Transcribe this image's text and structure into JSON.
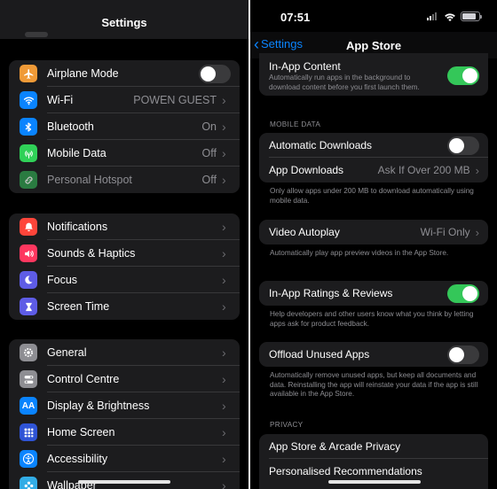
{
  "left": {
    "title": "Settings",
    "groups": [
      {
        "rows": [
          {
            "label": "Airplane Mode",
            "icon": "airplane-icon",
            "color": "#f09a37",
            "type": "toggle",
            "on": false
          },
          {
            "label": "Wi-Fi",
            "value": "POWEN GUEST",
            "icon": "wifi-icon",
            "color": "#0a84ff"
          },
          {
            "label": "Bluetooth",
            "value": "On",
            "icon": "bluetooth-icon",
            "color": "#0a84ff"
          },
          {
            "label": "Mobile Data",
            "value": "Off",
            "icon": "antenna-icon",
            "color": "#30d158"
          },
          {
            "label": "Personal Hotspot",
            "value": "Off",
            "icon": "hotspot-icon",
            "color": "#2a7b41"
          }
        ]
      },
      {
        "rows": [
          {
            "label": "Notifications",
            "icon": "bell-icon",
            "color": "#ff453a"
          },
          {
            "label": "Sounds & Haptics",
            "icon": "speaker-icon",
            "color": "#ff375f"
          },
          {
            "label": "Focus",
            "icon": "moon-icon",
            "color": "#5e5ce6"
          },
          {
            "label": "Screen Time",
            "icon": "hourglass-icon",
            "color": "#5e5ce6"
          }
        ]
      },
      {
        "rows": [
          {
            "label": "General",
            "icon": "gear-icon",
            "color": "#8e8e93"
          },
          {
            "label": "Control Centre",
            "icon": "switches-icon",
            "color": "#8e8e93"
          },
          {
            "label": "Display & Brightness",
            "icon": "aa-icon",
            "color": "#0a84ff"
          },
          {
            "label": "Home Screen",
            "icon": "grid-icon",
            "color": "#2f54d6"
          },
          {
            "label": "Accessibility",
            "icon": "accessibility-icon",
            "color": "#0a84ff"
          },
          {
            "label": "Wallpaper",
            "icon": "flower-icon",
            "color": "#32ade6"
          }
        ]
      }
    ]
  },
  "right": {
    "time": "07:51",
    "back_label": "Settings",
    "title": "App Store",
    "in_app_content": {
      "label": "In-App Content",
      "desc": "Automatically run apps in the background to download content before you first launch them.",
      "on": true
    },
    "mobile_data_header": "MOBILE DATA",
    "automatic_downloads": {
      "label": "Automatic Downloads",
      "on": false
    },
    "app_downloads": {
      "label": "App Downloads",
      "value": "Ask If Over 200 MB"
    },
    "app_downloads_desc": "Only allow apps under 200 MB to download automatically using mobile data.",
    "video_autoplay": {
      "label": "Video Autoplay",
      "value": "Wi-Fi Only"
    },
    "video_autoplay_desc": "Automatically play app preview videos in the App Store.",
    "ratings": {
      "label": "In-App Ratings & Reviews",
      "on": true
    },
    "ratings_desc": "Help developers and other users know what you think by letting apps ask for product feedback.",
    "offload": {
      "label": "Offload Unused Apps",
      "on": false
    },
    "offload_desc": "Automatically remove unused apps, but keep all documents and data. Reinstalling the app will reinstate your data if the app is still available in the App Store.",
    "privacy_header": "PRIVACY",
    "privacy_links": [
      "App Store & Arcade Privacy",
      "Personalised Recommendations"
    ]
  },
  "colors": {
    "accent": "#0a84ff",
    "toggle_on": "#34c759",
    "cell_bg": "#1c1c1e"
  }
}
